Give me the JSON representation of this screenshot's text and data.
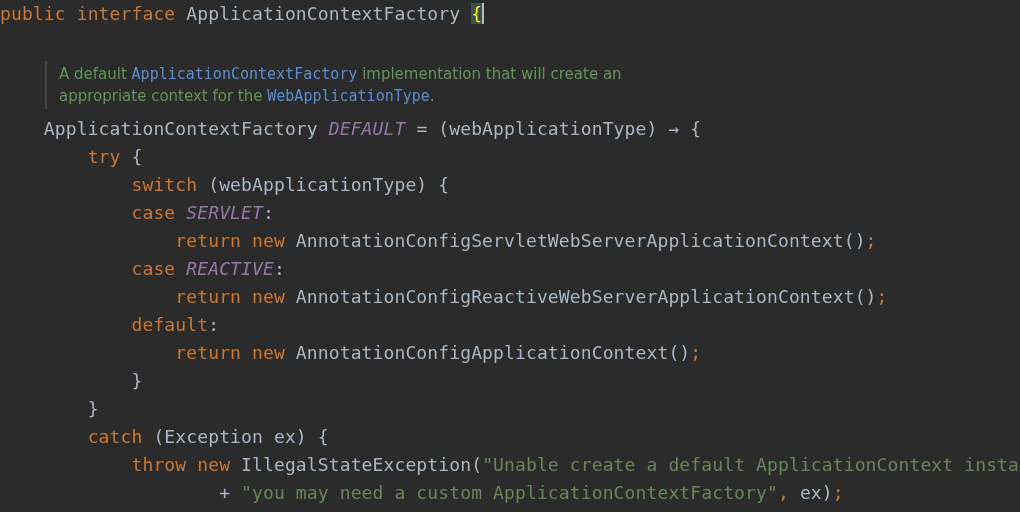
{
  "editor": {
    "first_line": [
      {
        "kind": "keyword",
        "text": "public interface "
      },
      {
        "kind": "plain",
        "text": "ApplicationContextFactory "
      },
      {
        "kind": "matched-brace",
        "text": "{"
      }
    ],
    "doc_comment": [
      [
        {
          "kind": "text",
          "text": "A default "
        },
        {
          "kind": "code",
          "text": "ApplicationContextFactory"
        },
        {
          "kind": "text",
          "text": " implementation that will create an"
        }
      ],
      [
        {
          "kind": "text",
          "text": "appropriate context for the "
        },
        {
          "kind": "code",
          "text": "WebApplicationType"
        },
        {
          "kind": "text",
          "text": "."
        }
      ]
    ],
    "lines": [
      [
        {
          "kind": "plain",
          "text": "    ApplicationContextFactory "
        },
        {
          "kind": "constant",
          "text": "DEFAULT"
        },
        {
          "kind": "plain",
          "text": " = (webApplicationType) → {"
        }
      ],
      [
        {
          "kind": "keyword",
          "text": "        try "
        },
        {
          "kind": "plain",
          "text": "{"
        }
      ],
      [
        {
          "kind": "keyword",
          "text": "            switch "
        },
        {
          "kind": "plain",
          "text": "(webApplicationType) {"
        }
      ],
      [
        {
          "kind": "keyword",
          "text": "            case "
        },
        {
          "kind": "constant",
          "text": "SERVLET"
        },
        {
          "kind": "plain",
          "text": ":"
        }
      ],
      [
        {
          "kind": "keyword",
          "text": "                return new "
        },
        {
          "kind": "plain",
          "text": "AnnotationConfigServletWebServerApplicationContext()"
        },
        {
          "kind": "keyword",
          "text": ";"
        }
      ],
      [
        {
          "kind": "keyword",
          "text": "            case "
        },
        {
          "kind": "constant",
          "text": "REACTIVE"
        },
        {
          "kind": "plain",
          "text": ":"
        }
      ],
      [
        {
          "kind": "keyword",
          "text": "                return new "
        },
        {
          "kind": "plain",
          "text": "AnnotationConfigReactiveWebServerApplicationContext()"
        },
        {
          "kind": "keyword",
          "text": ";"
        }
      ],
      [
        {
          "kind": "keyword",
          "text": "            default"
        },
        {
          "kind": "plain",
          "text": ":"
        }
      ],
      [
        {
          "kind": "keyword",
          "text": "                return new "
        },
        {
          "kind": "plain",
          "text": "AnnotationConfigApplicationContext()"
        },
        {
          "kind": "keyword",
          "text": ";"
        }
      ],
      [
        {
          "kind": "plain",
          "text": "            }"
        }
      ],
      [
        {
          "kind": "plain",
          "text": "        }"
        }
      ],
      [
        {
          "kind": "keyword",
          "text": "        catch "
        },
        {
          "kind": "plain",
          "text": "(Exception ex) {"
        }
      ],
      [
        {
          "kind": "keyword",
          "text": "            throw new "
        },
        {
          "kind": "plain",
          "text": "IllegalStateException("
        },
        {
          "kind": "string",
          "text": "\"Unable create a default ApplicationContext insta"
        }
      ],
      [
        {
          "kind": "plain",
          "text": "                    + "
        },
        {
          "kind": "string",
          "text": "\"you may need a custom ApplicationContextFactory\""
        },
        {
          "kind": "keyword",
          "text": ", "
        },
        {
          "kind": "plain",
          "text": "ex)"
        },
        {
          "kind": "keyword",
          "text": ";"
        }
      ]
    ]
  }
}
